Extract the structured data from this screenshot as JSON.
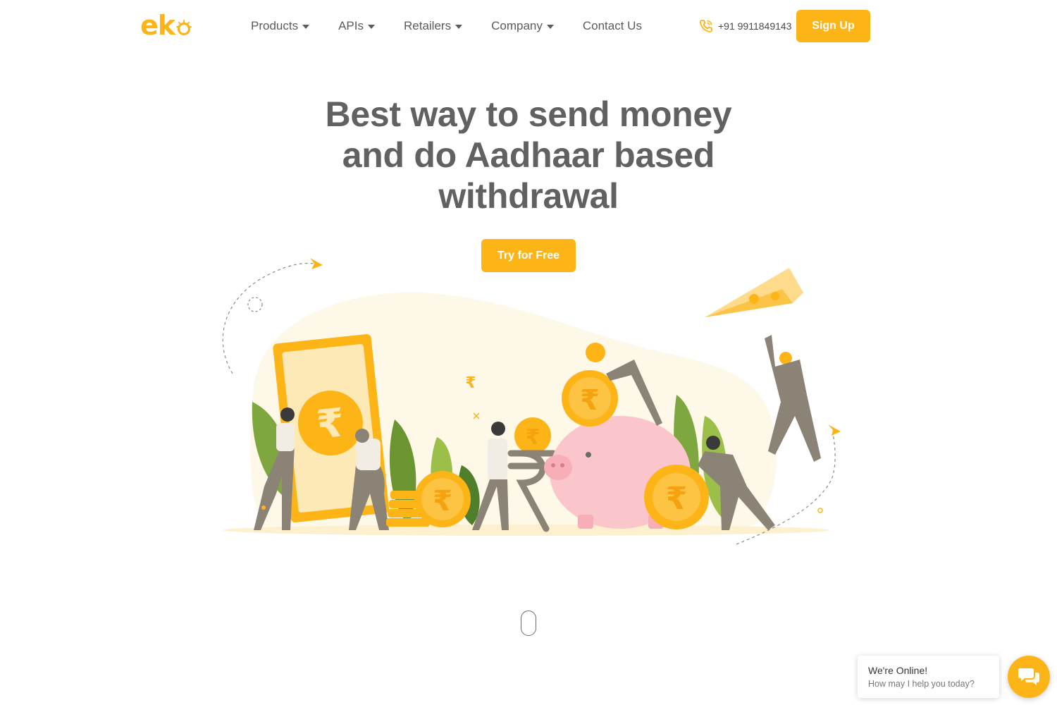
{
  "brand": {
    "logo_text": "ek",
    "accent": "#fcb417"
  },
  "nav": {
    "items": [
      {
        "label": "Products",
        "has_dropdown": true
      },
      {
        "label": "APIs",
        "has_dropdown": true
      },
      {
        "label": "Retailers",
        "has_dropdown": true
      },
      {
        "label": "Company",
        "has_dropdown": true
      },
      {
        "label": "Contact Us",
        "has_dropdown": false
      }
    ]
  },
  "header": {
    "phone": "+91 9911849143",
    "phone_icon": "phone-icon",
    "signup_label": "Sign Up"
  },
  "hero": {
    "title_line1": "Best way to send money",
    "title_line2": "and do Aadhaar based",
    "title_line3": "withdrawal",
    "cta_label": "Try for Free",
    "illustration_icon": "money-transfer-illustration"
  },
  "chat": {
    "title": "We're Online!",
    "subtitle": "How may I help you today?",
    "icon": "chat-bubble-icon"
  }
}
